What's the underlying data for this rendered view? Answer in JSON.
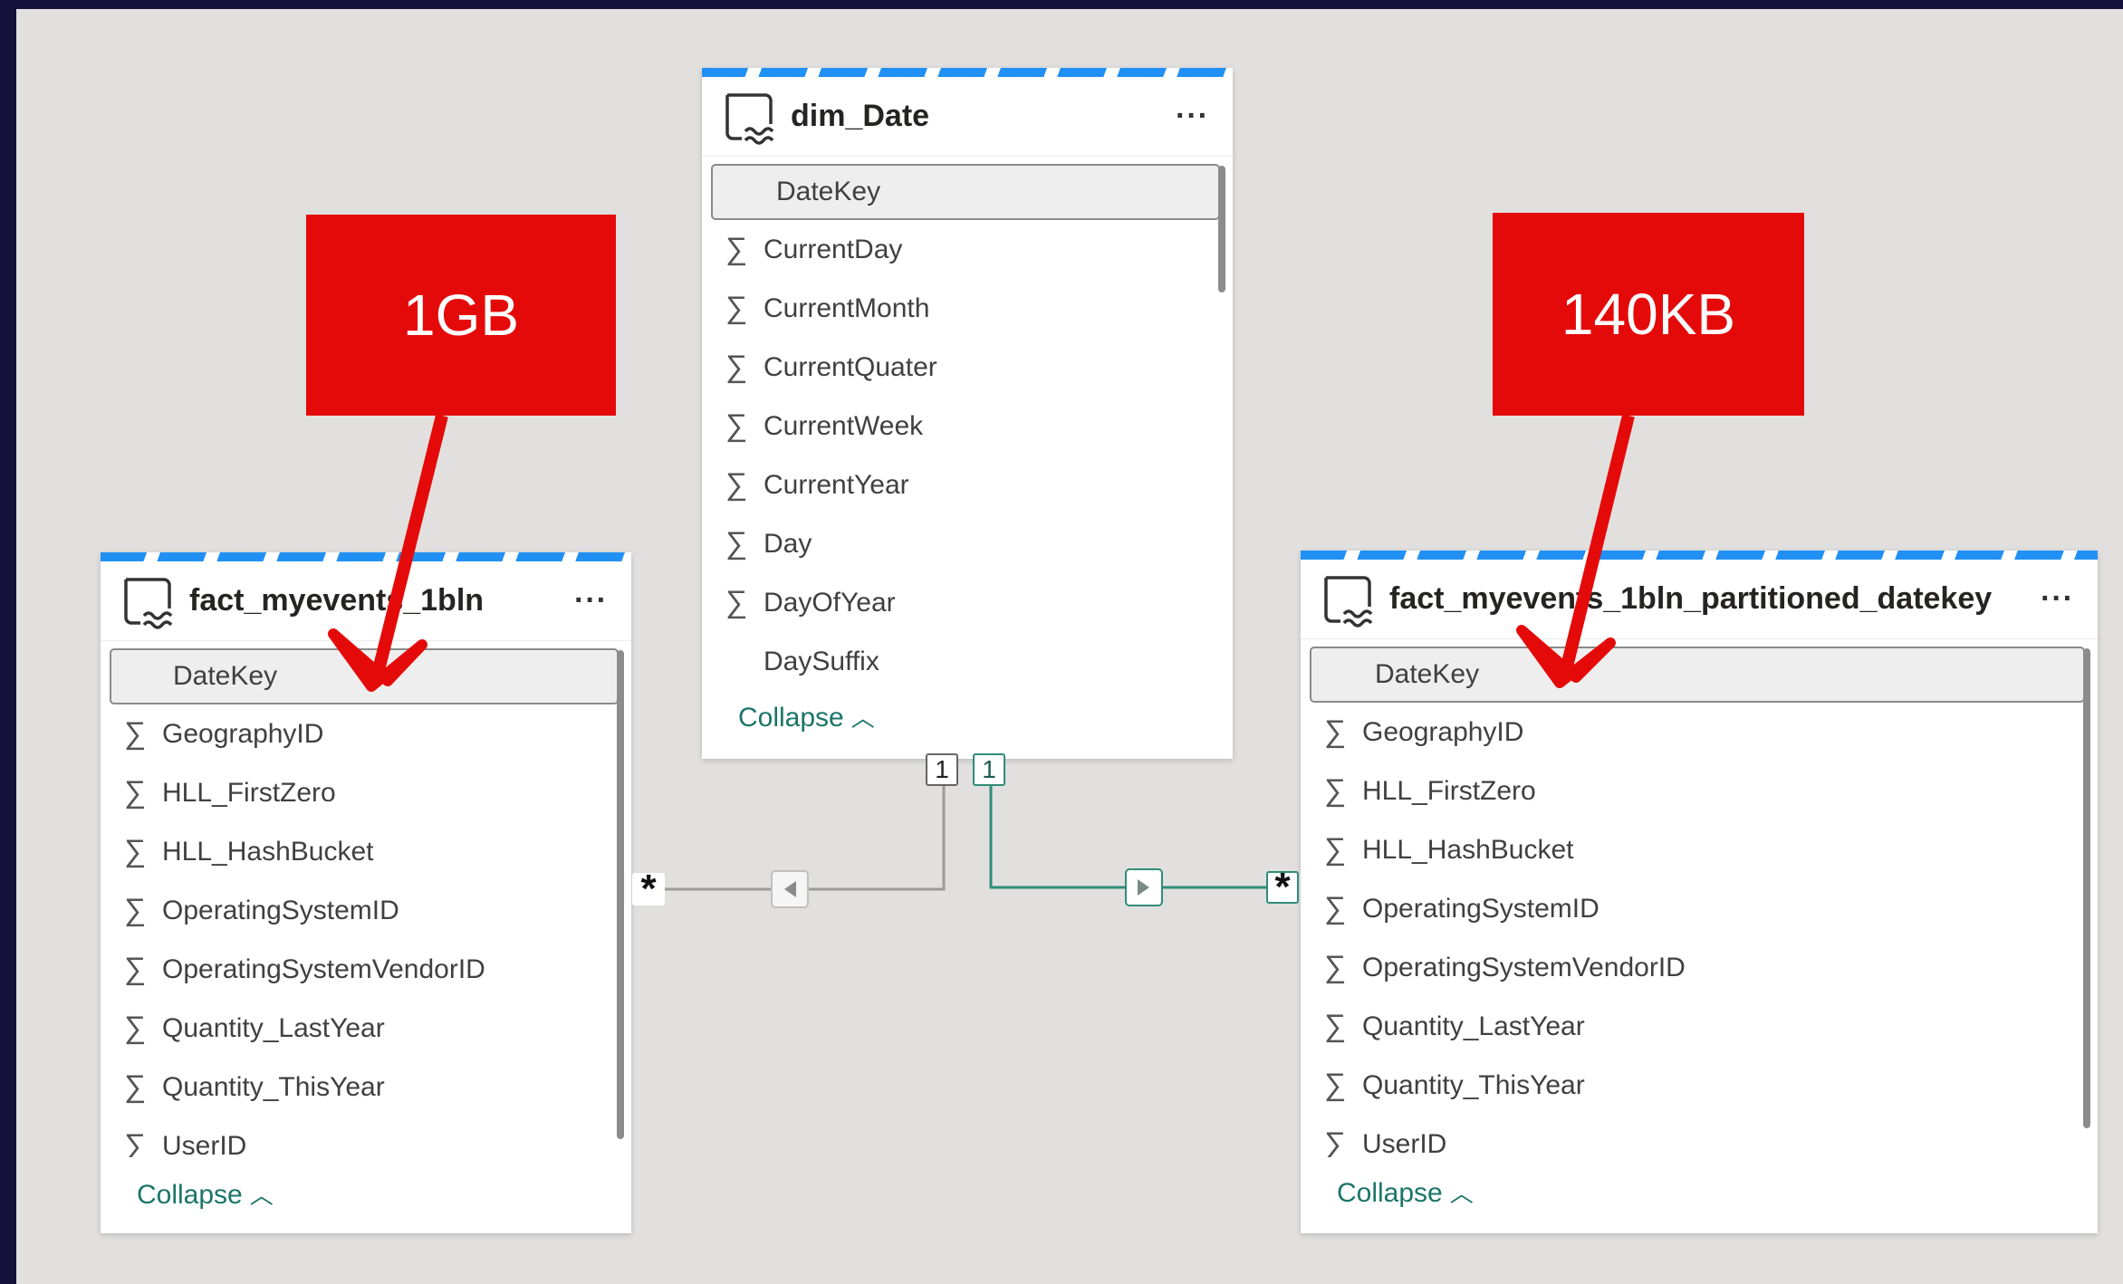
{
  "callouts": {
    "left": "1GB",
    "right": "140KB"
  },
  "colors": {
    "accent": "#2190f5",
    "callout": "#e50a0a",
    "relationship_active": "#2f8c7a",
    "relationship_inactive": "#9a9a9a",
    "link": "#1b7568"
  },
  "relationships": {
    "left": {
      "one": "1",
      "many": "*"
    },
    "right": {
      "one": "1",
      "many": "*"
    }
  },
  "tables": {
    "dim_date": {
      "title": "dim_Date",
      "key_field": "DateKey",
      "fields": [
        {
          "name": "CurrentDay",
          "sigma": true
        },
        {
          "name": "CurrentMonth",
          "sigma": true
        },
        {
          "name": "CurrentQuater",
          "sigma": true
        },
        {
          "name": "CurrentWeek",
          "sigma": true
        },
        {
          "name": "CurrentYear",
          "sigma": true
        },
        {
          "name": "Day",
          "sigma": true
        },
        {
          "name": "DayOfYear",
          "sigma": true
        },
        {
          "name": "DaySuffix",
          "sigma": false
        }
      ],
      "collapse_label": "Collapse",
      "icon": "lakehouse-table-icon"
    },
    "fact_left": {
      "title": "fact_myevents_1bln",
      "key_field": "DateKey",
      "fields": [
        {
          "name": "GeographyID",
          "sigma": true
        },
        {
          "name": "HLL_FirstZero",
          "sigma": true
        },
        {
          "name": "HLL_HashBucket",
          "sigma": true
        },
        {
          "name": "OperatingSystemID",
          "sigma": true
        },
        {
          "name": "OperatingSystemVendorID",
          "sigma": true
        },
        {
          "name": "Quantity_LastYear",
          "sigma": true
        },
        {
          "name": "Quantity_ThisYear",
          "sigma": true
        },
        {
          "name": "UserID",
          "sigma": true
        }
      ],
      "collapse_label": "Collapse",
      "icon": "lakehouse-table-icon"
    },
    "fact_right": {
      "title": "fact_myevents_1bln_partitioned_datekey",
      "key_field": "DateKey",
      "fields": [
        {
          "name": "GeographyID",
          "sigma": true
        },
        {
          "name": "HLL_FirstZero",
          "sigma": true
        },
        {
          "name": "HLL_HashBucket",
          "sigma": true
        },
        {
          "name": "OperatingSystemID",
          "sigma": true
        },
        {
          "name": "OperatingSystemVendorID",
          "sigma": true
        },
        {
          "name": "Quantity_LastYear",
          "sigma": true
        },
        {
          "name": "Quantity_ThisYear",
          "sigma": true
        },
        {
          "name": "UserID",
          "sigma": true
        }
      ],
      "collapse_label": "Collapse",
      "icon": "lakehouse-table-icon"
    }
  },
  "sigma_symbol": "∑",
  "more_symbol": "···"
}
